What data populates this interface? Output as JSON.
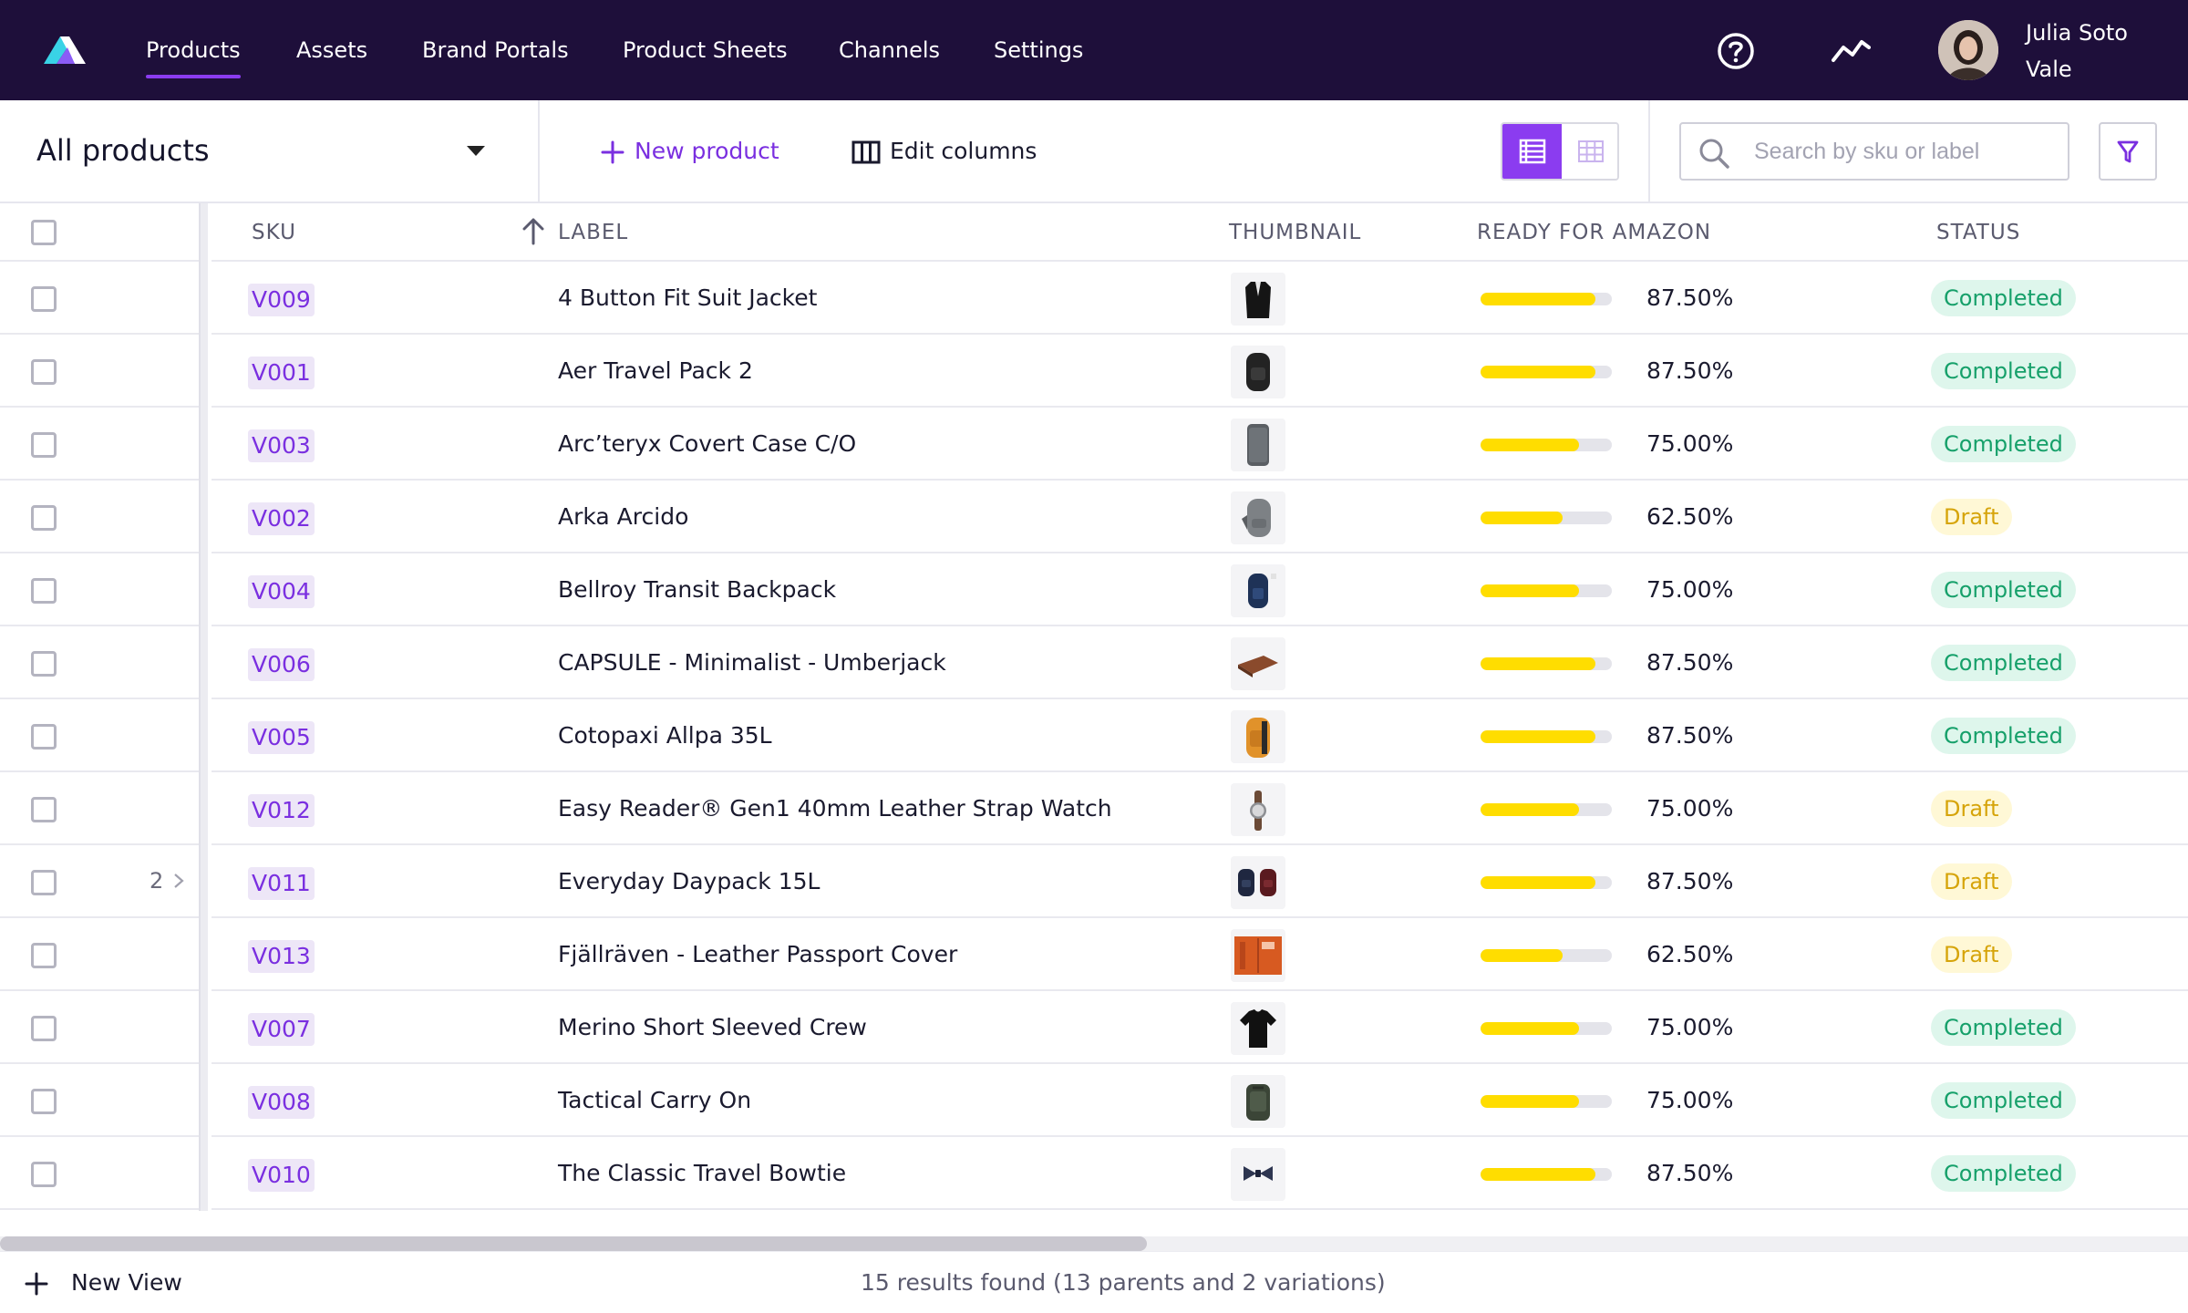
{
  "nav": {
    "items": [
      {
        "label": "Products",
        "active": true
      },
      {
        "label": "Assets"
      },
      {
        "label": "Brand Portals"
      },
      {
        "label": "Product Sheets"
      },
      {
        "label": "Channels"
      },
      {
        "label": "Settings"
      }
    ],
    "icons": [
      "help-icon",
      "activity-icon"
    ],
    "user": {
      "name_line1": "Julia Soto",
      "name_line2": "Vale"
    },
    "active_color": "#8b3cf0",
    "bg_color": "#1e0f3a"
  },
  "toolbar": {
    "view_label": "All products",
    "new_product_label": "New product",
    "edit_columns_label": "Edit columns",
    "search_placeholder": "Search by sku or label",
    "view_mode": "list"
  },
  "table": {
    "headers": {
      "sku": "SKU",
      "label": "LABEL",
      "thumbnail": "THUMBNAIL",
      "ready": "READY FOR AMAZON",
      "status": "STATUS"
    },
    "sort": {
      "column": "label",
      "direction": "ascending"
    },
    "rows": [
      {
        "sku": "V009",
        "label": "4 Button Fit Suit Jacket",
        "thumb": "suit-jacket",
        "ready": 0.875,
        "ready_text": "87.50%",
        "status": "Completed"
      },
      {
        "sku": "V001",
        "label": "Aer Travel Pack 2",
        "thumb": "backpack-black",
        "ready": 0.875,
        "ready_text": "87.50%",
        "status": "Completed"
      },
      {
        "sku": "V003",
        "label": "Arc’teryx Covert Case C/O",
        "thumb": "case-grey",
        "ready": 0.75,
        "ready_text": "75.00%",
        "status": "Completed"
      },
      {
        "sku": "V002",
        "label": "Arka Arcido",
        "thumb": "backpack-grey",
        "ready": 0.625,
        "ready_text": "62.50%",
        "status": "Draft"
      },
      {
        "sku": "V004",
        "label": "Bellroy Transit Backpack",
        "thumb": "backpack-navy",
        "ready": 0.75,
        "ready_text": "75.00%",
        "status": "Completed"
      },
      {
        "sku": "V006",
        "label": "CAPSULE - Minimalist - Umberjack",
        "thumb": "wallet-brown",
        "ready": 0.875,
        "ready_text": "87.50%",
        "status": "Completed"
      },
      {
        "sku": "V005",
        "label": "Cotopaxi Allpa 35L",
        "thumb": "backpack-orange",
        "ready": 0.875,
        "ready_text": "87.50%",
        "status": "Completed"
      },
      {
        "sku": "V012",
        "label": "Easy Reader® Gen1 40mm Leather Strap Watch",
        "thumb": "watch",
        "ready": 0.75,
        "ready_text": "75.00%",
        "status": "Draft"
      },
      {
        "sku": "V011",
        "label": "Everyday Daypack 15L",
        "thumb": "daypacks",
        "ready": 0.875,
        "ready_text": "87.50%",
        "status": "Draft",
        "variations": "2"
      },
      {
        "sku": "V013",
        "label": "Fjällräven - Leather Passport Cover",
        "thumb": "passport-cover",
        "ready": 0.625,
        "ready_text": "62.50%",
        "status": "Draft"
      },
      {
        "sku": "V007",
        "label": "Merino Short Sleeved Crew",
        "thumb": "tshirt",
        "ready": 0.75,
        "ready_text": "75.00%",
        "status": "Completed"
      },
      {
        "sku": "V008",
        "label": "Tactical Carry On",
        "thumb": "carry-on",
        "ready": 0.75,
        "ready_text": "75.00%",
        "status": "Completed"
      },
      {
        "sku": "V010",
        "label": "The Classic Travel Bowtie",
        "thumb": "bowtie",
        "ready": 0.875,
        "ready_text": "87.50%",
        "status": "Completed"
      }
    ],
    "progress_color": "#ffdd00"
  },
  "footer": {
    "new_view_label": "New View",
    "results_text": "15 results found (13 parents and 2 variations)"
  }
}
